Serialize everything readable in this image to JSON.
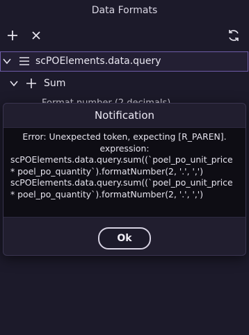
{
  "window": {
    "title": "Data Formats"
  },
  "toolbar": {
    "add_icon": "plus-icon",
    "close_icon": "close-icon",
    "refresh_icon": "refresh-icon"
  },
  "tree": {
    "root_label": "scPOElements.data.query",
    "child_label": "Sum",
    "grandchild_label": "Format number (2 decimals)"
  },
  "dialog": {
    "title": "Notification",
    "lines": [
      "Error: Unexpected token, expecting [R_PAREN].",
      "expression:",
      "scPOElements.data.query.sum((`poel_po_unit_price",
      "* poel_po_quantity`).formatNumber(2, '.', ',')",
      "scPOElements.data.query.sum((`poel_po_unit_price",
      "* poel_po_quantity`).formatNumber(2, '.', ',')"
    ],
    "ok_label": "Ok"
  },
  "colors": {
    "background": "#1c1a2a",
    "selection_border": "#6e5ca8",
    "dialog_body": "#0e0d14"
  }
}
